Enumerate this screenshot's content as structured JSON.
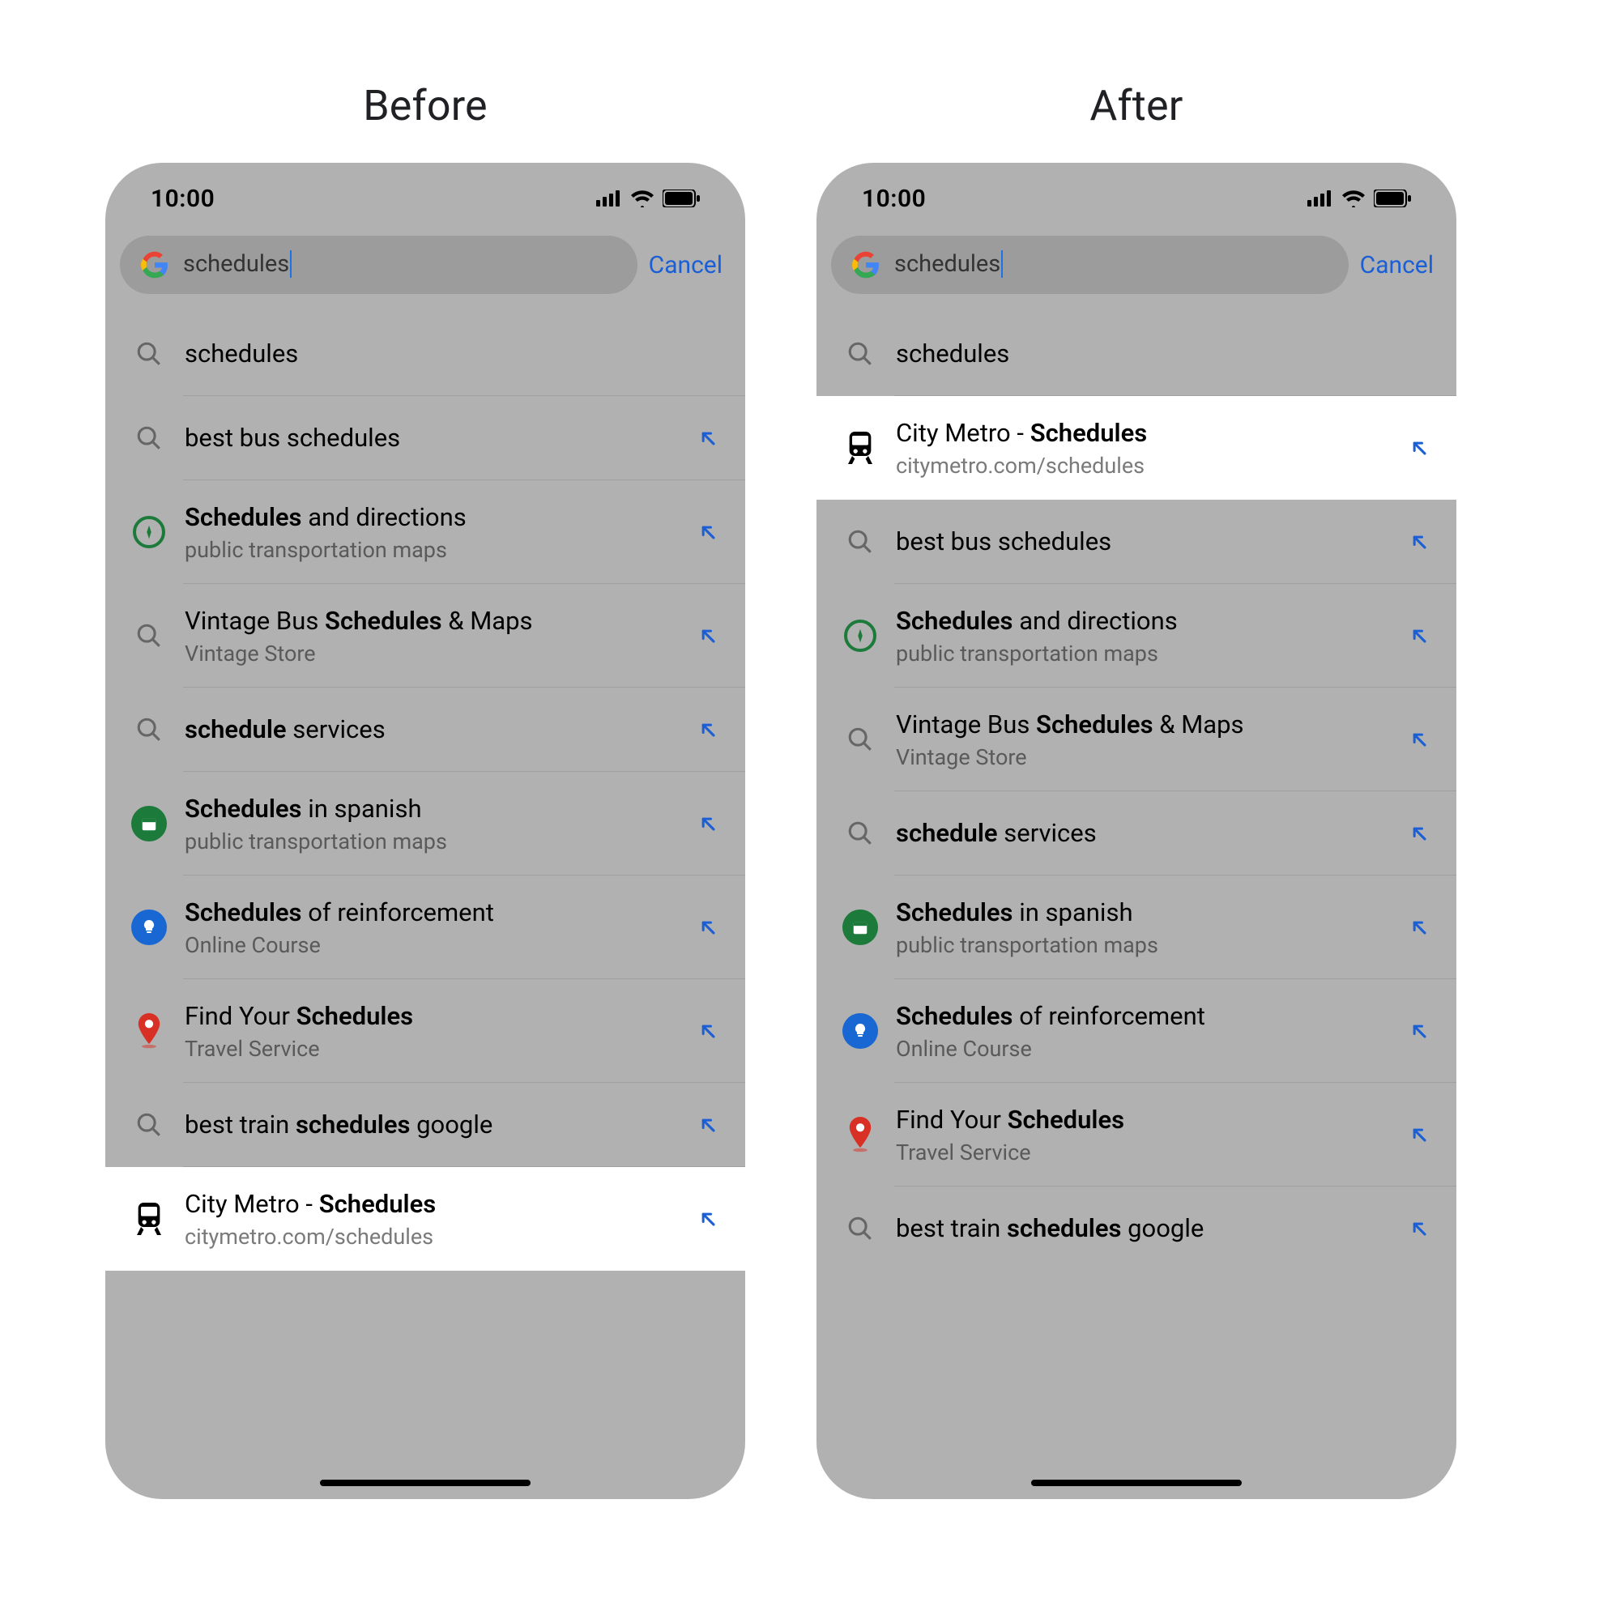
{
  "headings": {
    "before": "Before",
    "after": "After"
  },
  "status": {
    "time": "10:00"
  },
  "search": {
    "query": "schedules",
    "cancel": "Cancel"
  },
  "colors": {
    "link": "#1a5fd6",
    "highlightBg": "#ffffff",
    "dimBg": "#b1b1b1"
  },
  "arrow_icon_name": "arrow-up-left-icon",
  "suggestions_before": [
    {
      "icon": "search",
      "title_parts": [
        [
          "schedules",
          false
        ]
      ],
      "sub": null,
      "arrow": false
    },
    {
      "icon": "search",
      "title_parts": [
        [
          "best bus schedules",
          false
        ]
      ],
      "sub": null,
      "arrow": true
    },
    {
      "icon": "compass",
      "title_parts": [
        [
          "Schedules",
          true
        ],
        [
          " and directions",
          false
        ]
      ],
      "sub": "public transportation maps",
      "arrow": true
    },
    {
      "icon": "search",
      "title_parts": [
        [
          "Vintage Bus ",
          false
        ],
        [
          "Schedules",
          true
        ],
        [
          " & Maps",
          false
        ]
      ],
      "sub": "Vintage Store",
      "arrow": true
    },
    {
      "icon": "search",
      "title_parts": [
        [
          "schedule",
          true
        ],
        [
          " services",
          false
        ]
      ],
      "sub": null,
      "arrow": true
    },
    {
      "icon": "calendar",
      "title_parts": [
        [
          "Schedules",
          true
        ],
        [
          " in spanish",
          false
        ]
      ],
      "sub": "public transportation maps",
      "arrow": true
    },
    {
      "icon": "bulb",
      "title_parts": [
        [
          "Schedules",
          true
        ],
        [
          " of reinforcement",
          false
        ]
      ],
      "sub": "Online Course",
      "arrow": true
    },
    {
      "icon": "pin",
      "title_parts": [
        [
          "Find Your ",
          false
        ],
        [
          "Schedules",
          true
        ]
      ],
      "sub": "Travel Service",
      "arrow": true
    },
    {
      "icon": "search",
      "title_parts": [
        [
          "best train ",
          false
        ],
        [
          "schedules",
          true
        ],
        [
          " google",
          false
        ]
      ],
      "sub": null,
      "arrow": true
    },
    {
      "icon": "train",
      "title_parts": [
        [
          "City Metro -  ",
          false
        ],
        [
          "Schedules",
          true
        ]
      ],
      "sub": "citymetro.com/schedules",
      "arrow": true,
      "highlight": true
    }
  ],
  "suggestions_after": [
    {
      "icon": "search",
      "title_parts": [
        [
          "schedules",
          false
        ]
      ],
      "sub": null,
      "arrow": false
    },
    {
      "icon": "train",
      "title_parts": [
        [
          "City Metro -  ",
          false
        ],
        [
          "Schedules",
          true
        ]
      ],
      "sub": "citymetro.com/schedules",
      "arrow": true,
      "highlight": true
    },
    {
      "icon": "search",
      "title_parts": [
        [
          "best bus schedules",
          false
        ]
      ],
      "sub": null,
      "arrow": true
    },
    {
      "icon": "compass",
      "title_parts": [
        [
          "Schedules",
          true
        ],
        [
          " and directions",
          false
        ]
      ],
      "sub": "public transportation maps",
      "arrow": true
    },
    {
      "icon": "search",
      "title_parts": [
        [
          "Vintage Bus ",
          false
        ],
        [
          "Schedules",
          true
        ],
        [
          " & Maps",
          false
        ]
      ],
      "sub": "Vintage Store",
      "arrow": true
    },
    {
      "icon": "search",
      "title_parts": [
        [
          "schedule",
          true
        ],
        [
          " services",
          false
        ]
      ],
      "sub": null,
      "arrow": true
    },
    {
      "icon": "calendar",
      "title_parts": [
        [
          "Schedules",
          true
        ],
        [
          " in spanish",
          false
        ]
      ],
      "sub": "public transportation maps",
      "arrow": true
    },
    {
      "icon": "bulb",
      "title_parts": [
        [
          "Schedules",
          true
        ],
        [
          " of reinforcement",
          false
        ]
      ],
      "sub": "Online Course",
      "arrow": true
    },
    {
      "icon": "pin",
      "title_parts": [
        [
          "Find Your ",
          false
        ],
        [
          "Schedules",
          true
        ]
      ],
      "sub": "Travel Service",
      "arrow": true
    },
    {
      "icon": "search",
      "title_parts": [
        [
          "best train ",
          false
        ],
        [
          "schedules",
          true
        ],
        [
          " google",
          false
        ]
      ],
      "sub": null,
      "arrow": true
    }
  ]
}
